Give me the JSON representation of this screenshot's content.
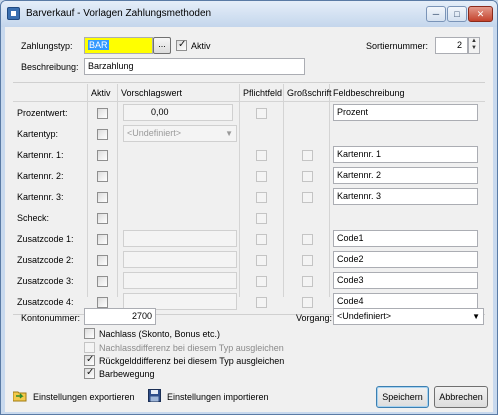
{
  "window": {
    "title": "Barverkauf - Vorlagen Zahlungsmethoden"
  },
  "header": {
    "zahlungstyp_label": "Zahlungstyp:",
    "zahlungstyp_value": "BAR",
    "browse_label": "...",
    "aktiv_label": "Aktiv",
    "aktiv_checked": true,
    "sortiernummer_label": "Sortiernummer:",
    "sortiernummer_value": "2",
    "beschreibung_label": "Beschreibung:",
    "beschreibung_value": "Barzahlung"
  },
  "grid": {
    "columns": [
      "Aktiv",
      "Vorschlagswert",
      "Pflichtfeld",
      "Großschrift",
      "Feldbeschreibung"
    ],
    "rows": [
      {
        "label": "Prozentwert:",
        "value": "0,00",
        "description": "Prozent"
      },
      {
        "label": "Kartentyp:",
        "value": "<Undefiniert>",
        "description": ""
      },
      {
        "label": "Kartennr. 1:",
        "value": "",
        "description": "Kartennr. 1"
      },
      {
        "label": "Kartennr. 2:",
        "value": "",
        "description": "Kartennr. 2"
      },
      {
        "label": "Kartennr. 3:",
        "value": "",
        "description": "Kartennr. 3"
      },
      {
        "label": "Scheck:",
        "value": "",
        "description": ""
      },
      {
        "label": "Zusatzcode 1:",
        "value": "",
        "description": "Code1"
      },
      {
        "label": "Zusatzcode 2:",
        "value": "",
        "description": "Code2"
      },
      {
        "label": "Zusatzcode 3:",
        "value": "",
        "description": "Code3"
      },
      {
        "label": "Zusatzcode 4:",
        "value": "",
        "description": "Code4"
      }
    ]
  },
  "footer": {
    "kontonummer_label": "Kontonummer:",
    "kontonummer_value": "2700",
    "vorgang_label": "Vorgang:",
    "vorgang_value": "<Undefiniert>",
    "nachlass_label": "Nachlass (Skonto, Bonus etc.)",
    "nachlassdiff_label": "Nachlassdifferenz bei diesem Typ ausgleichen",
    "rueckgeld_label": "Rückgelddifferenz bei diesem Typ ausgleichen",
    "barbewegung_label": "Barbewegung"
  },
  "buttons": {
    "export": "Einstellungen exportieren",
    "import": "Einstellungen importieren",
    "save": "Speichern",
    "cancel": "Abbrechen"
  },
  "icons": {
    "app": "app-icon",
    "export": "folder-export-icon",
    "import": "save-disk-icon",
    "close": "close-icon"
  }
}
